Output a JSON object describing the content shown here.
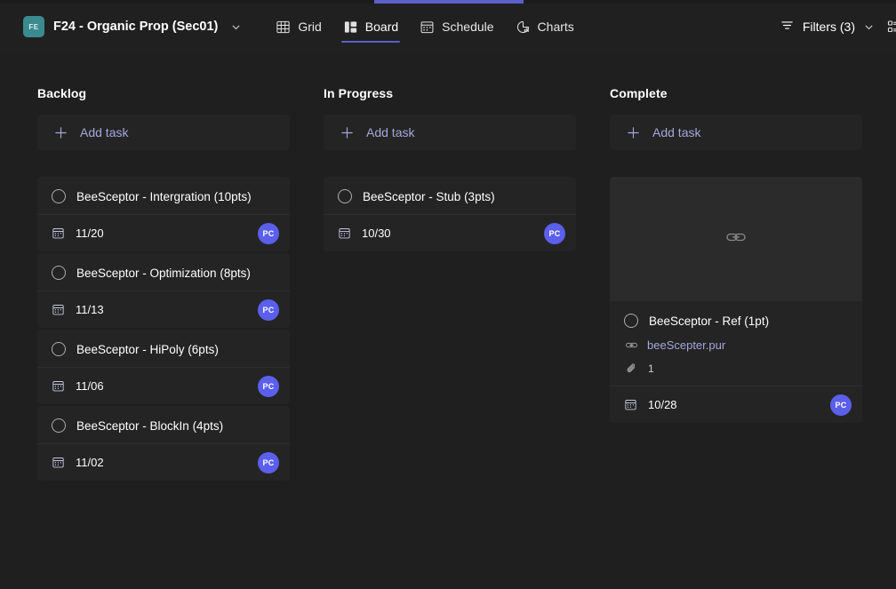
{
  "header": {
    "logo_text": "FE",
    "title": "F24 - Organic Prop (Sec01)",
    "title_chevron_icon": "chevron-down-icon",
    "tabs": [
      {
        "label": "Grid",
        "icon": "grid-icon",
        "active": false
      },
      {
        "label": "Board",
        "icon": "board-icon",
        "active": true
      },
      {
        "label": "Schedule",
        "icon": "calendar-icon",
        "active": false
      },
      {
        "label": "Charts",
        "icon": "chart-pie-icon",
        "active": false
      }
    ],
    "filters_label": "Filters (3)",
    "filters_icon": "filter-icon",
    "filters_chevron_icon": "chevron-down-icon",
    "groupby_icon": "group-by-icon",
    "accent_color": "#5b5fc7"
  },
  "board": {
    "add_task_label": "Add task",
    "add_task_icon": "plus-icon",
    "columns": [
      {
        "title": "Backlog",
        "cards": [
          {
            "title": "BeeSceptor - Intergration (10pts)",
            "date": "11/20",
            "avatar": "PC"
          },
          {
            "title": "BeeSceptor - Optimization (8pts)",
            "date": "11/13",
            "avatar": "PC"
          },
          {
            "title": "BeeSceptor - HiPoly (6pts)",
            "date": "11/06",
            "avatar": "PC"
          },
          {
            "title": "BeeSceptor - BlockIn (4pts)",
            "date": "11/02",
            "avatar": "PC"
          }
        ]
      },
      {
        "title": "In Progress",
        "cards": [
          {
            "title": "BeeSceptor - Stub (3pts)",
            "date": "10/30",
            "avatar": "PC"
          }
        ]
      },
      {
        "title": "Complete",
        "cards": [
          {
            "title": "BeeSceptor - Ref (1pt)",
            "date": "10/28",
            "avatar": "PC",
            "has_preview": true,
            "preview_icon": "link-icon",
            "link_text": "beeScepter.pur",
            "link_icon": "link-icon",
            "attachment_icon": "paperclip-icon",
            "attachment_count": "1"
          }
        ]
      }
    ]
  }
}
